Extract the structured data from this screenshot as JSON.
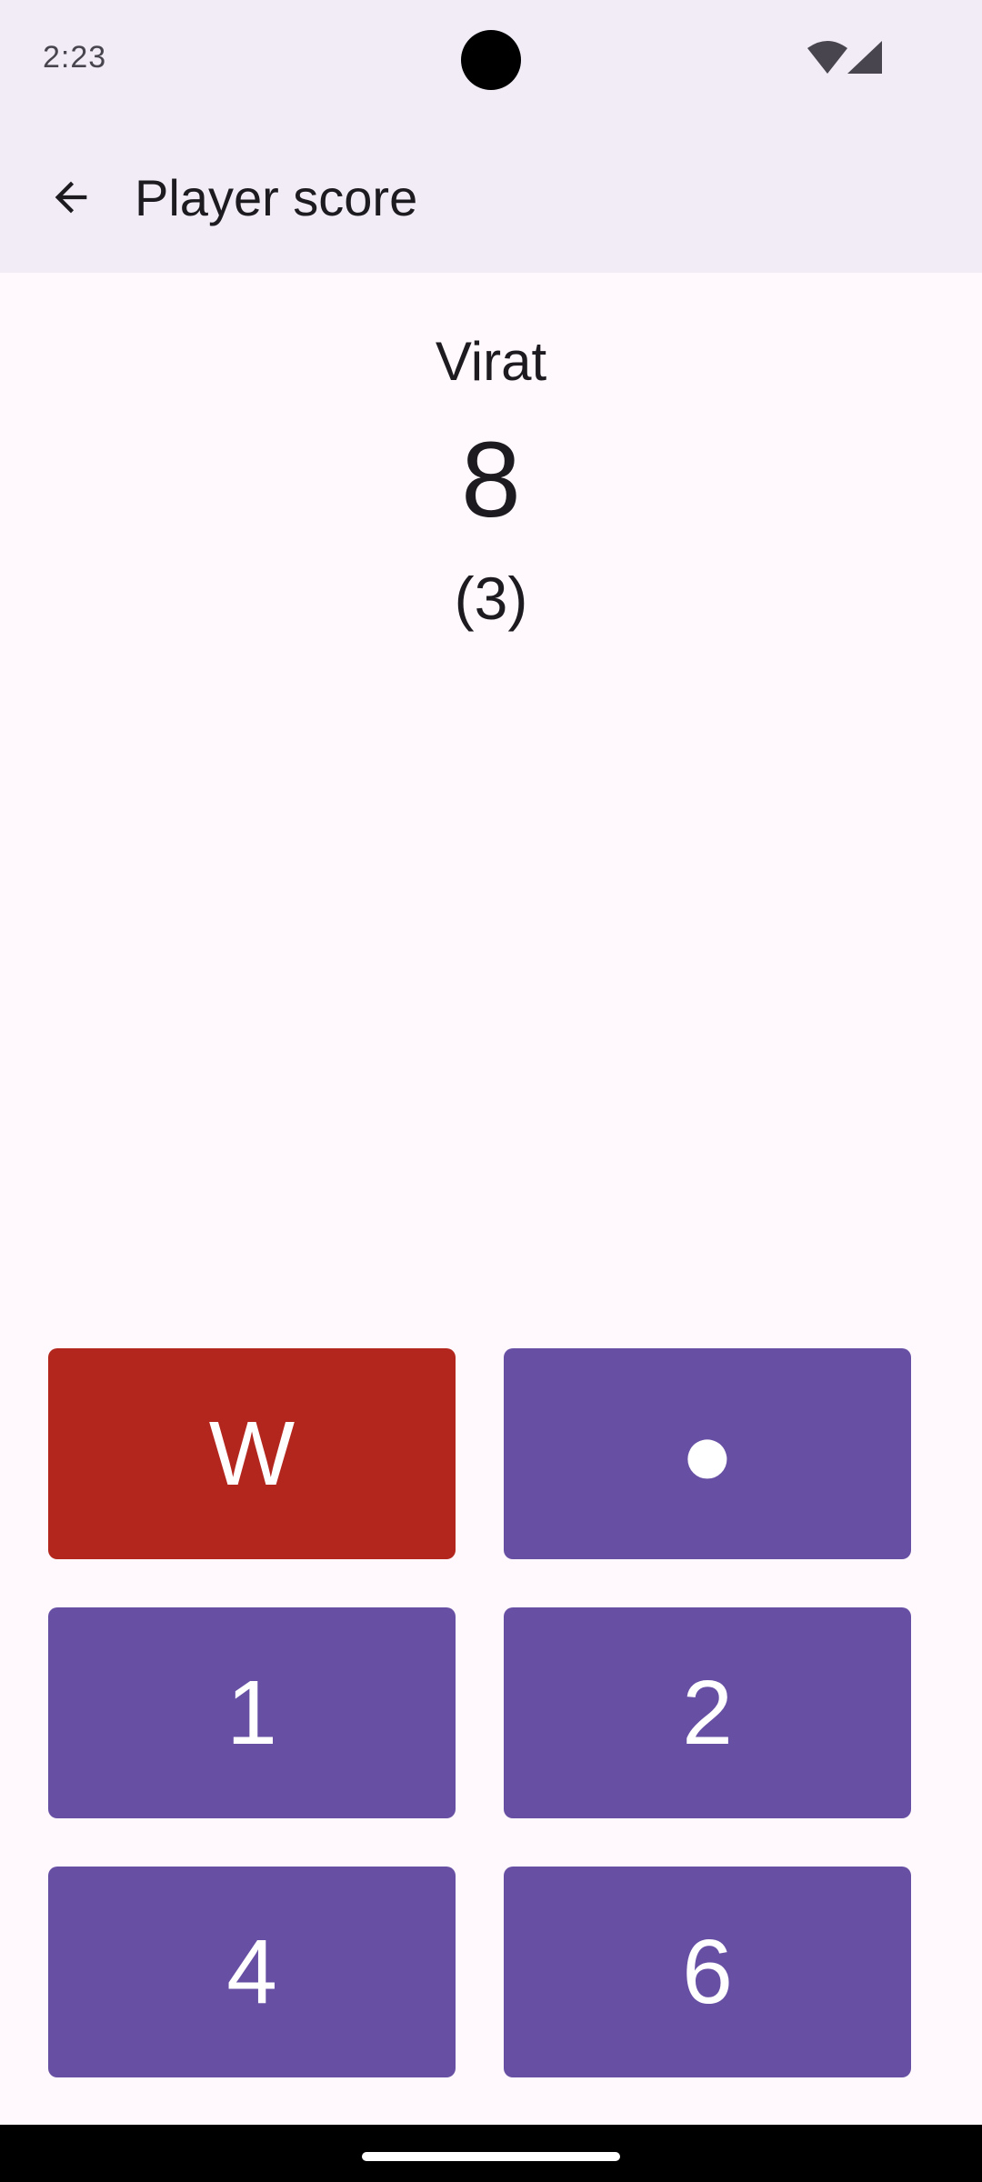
{
  "status_bar": {
    "time": "2:23",
    "icons": [
      "wifi-icon",
      "cellular-signal-icon"
    ]
  },
  "app_bar": {
    "back_icon": "arrow-back-icon",
    "title": "Player score"
  },
  "player": {
    "name": "Virat",
    "runs": "8",
    "balls": "(3)"
  },
  "keys": {
    "wicket": "W",
    "dot": "●",
    "one": "1",
    "two": "2",
    "four": "4",
    "six": "6"
  },
  "colors": {
    "primary": "#6750A4",
    "wicket": "#B3261E",
    "surface": "#FFF8FC",
    "app_bar": "#F1ECF5"
  }
}
